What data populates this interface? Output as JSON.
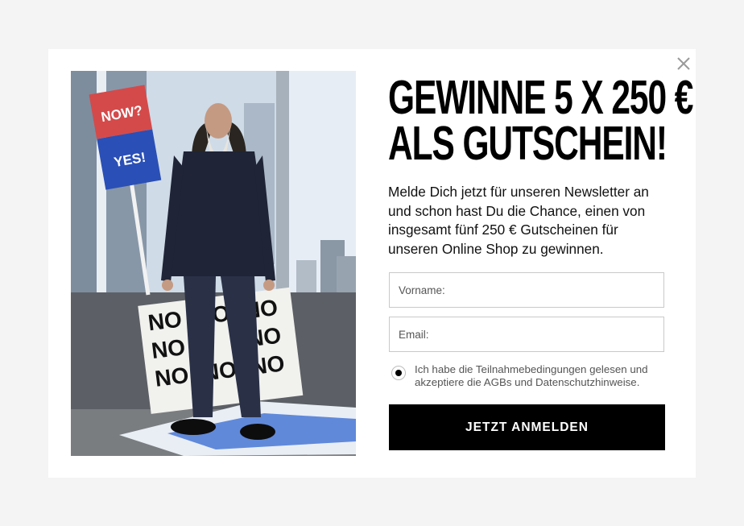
{
  "modal": {
    "close_icon": "close-icon",
    "image_alt_icon": "promo-photo",
    "sign": {
      "top": "NOW?",
      "bottom": "YES!",
      "top_color": "#d44a4a",
      "bottom_color": "#2a4fb6"
    },
    "poster_text": [
      "NO",
      "NO",
      "NO",
      "NO",
      "NO",
      "NO",
      "NO",
      "NO"
    ],
    "title_line1": "GEWINNE 5 X 250 €",
    "title_line2": "ALS GUTSCHEIN!",
    "description": "Melde Dich jetzt für unseren Newsletter an und schon hast Du die Chance, einen von insgesamt fünf 250 € Gutscheinen für unseren Online Shop zu gewinnen.",
    "firstname_placeholder": "Vorname:",
    "email_placeholder": "Email:",
    "consent_text": "Ich habe die Teilnahmebedingungen gelesen und akzeptiere die AGBs und Datenschutzhinweise.",
    "submit_label": "JETZT ANMELDEN"
  }
}
